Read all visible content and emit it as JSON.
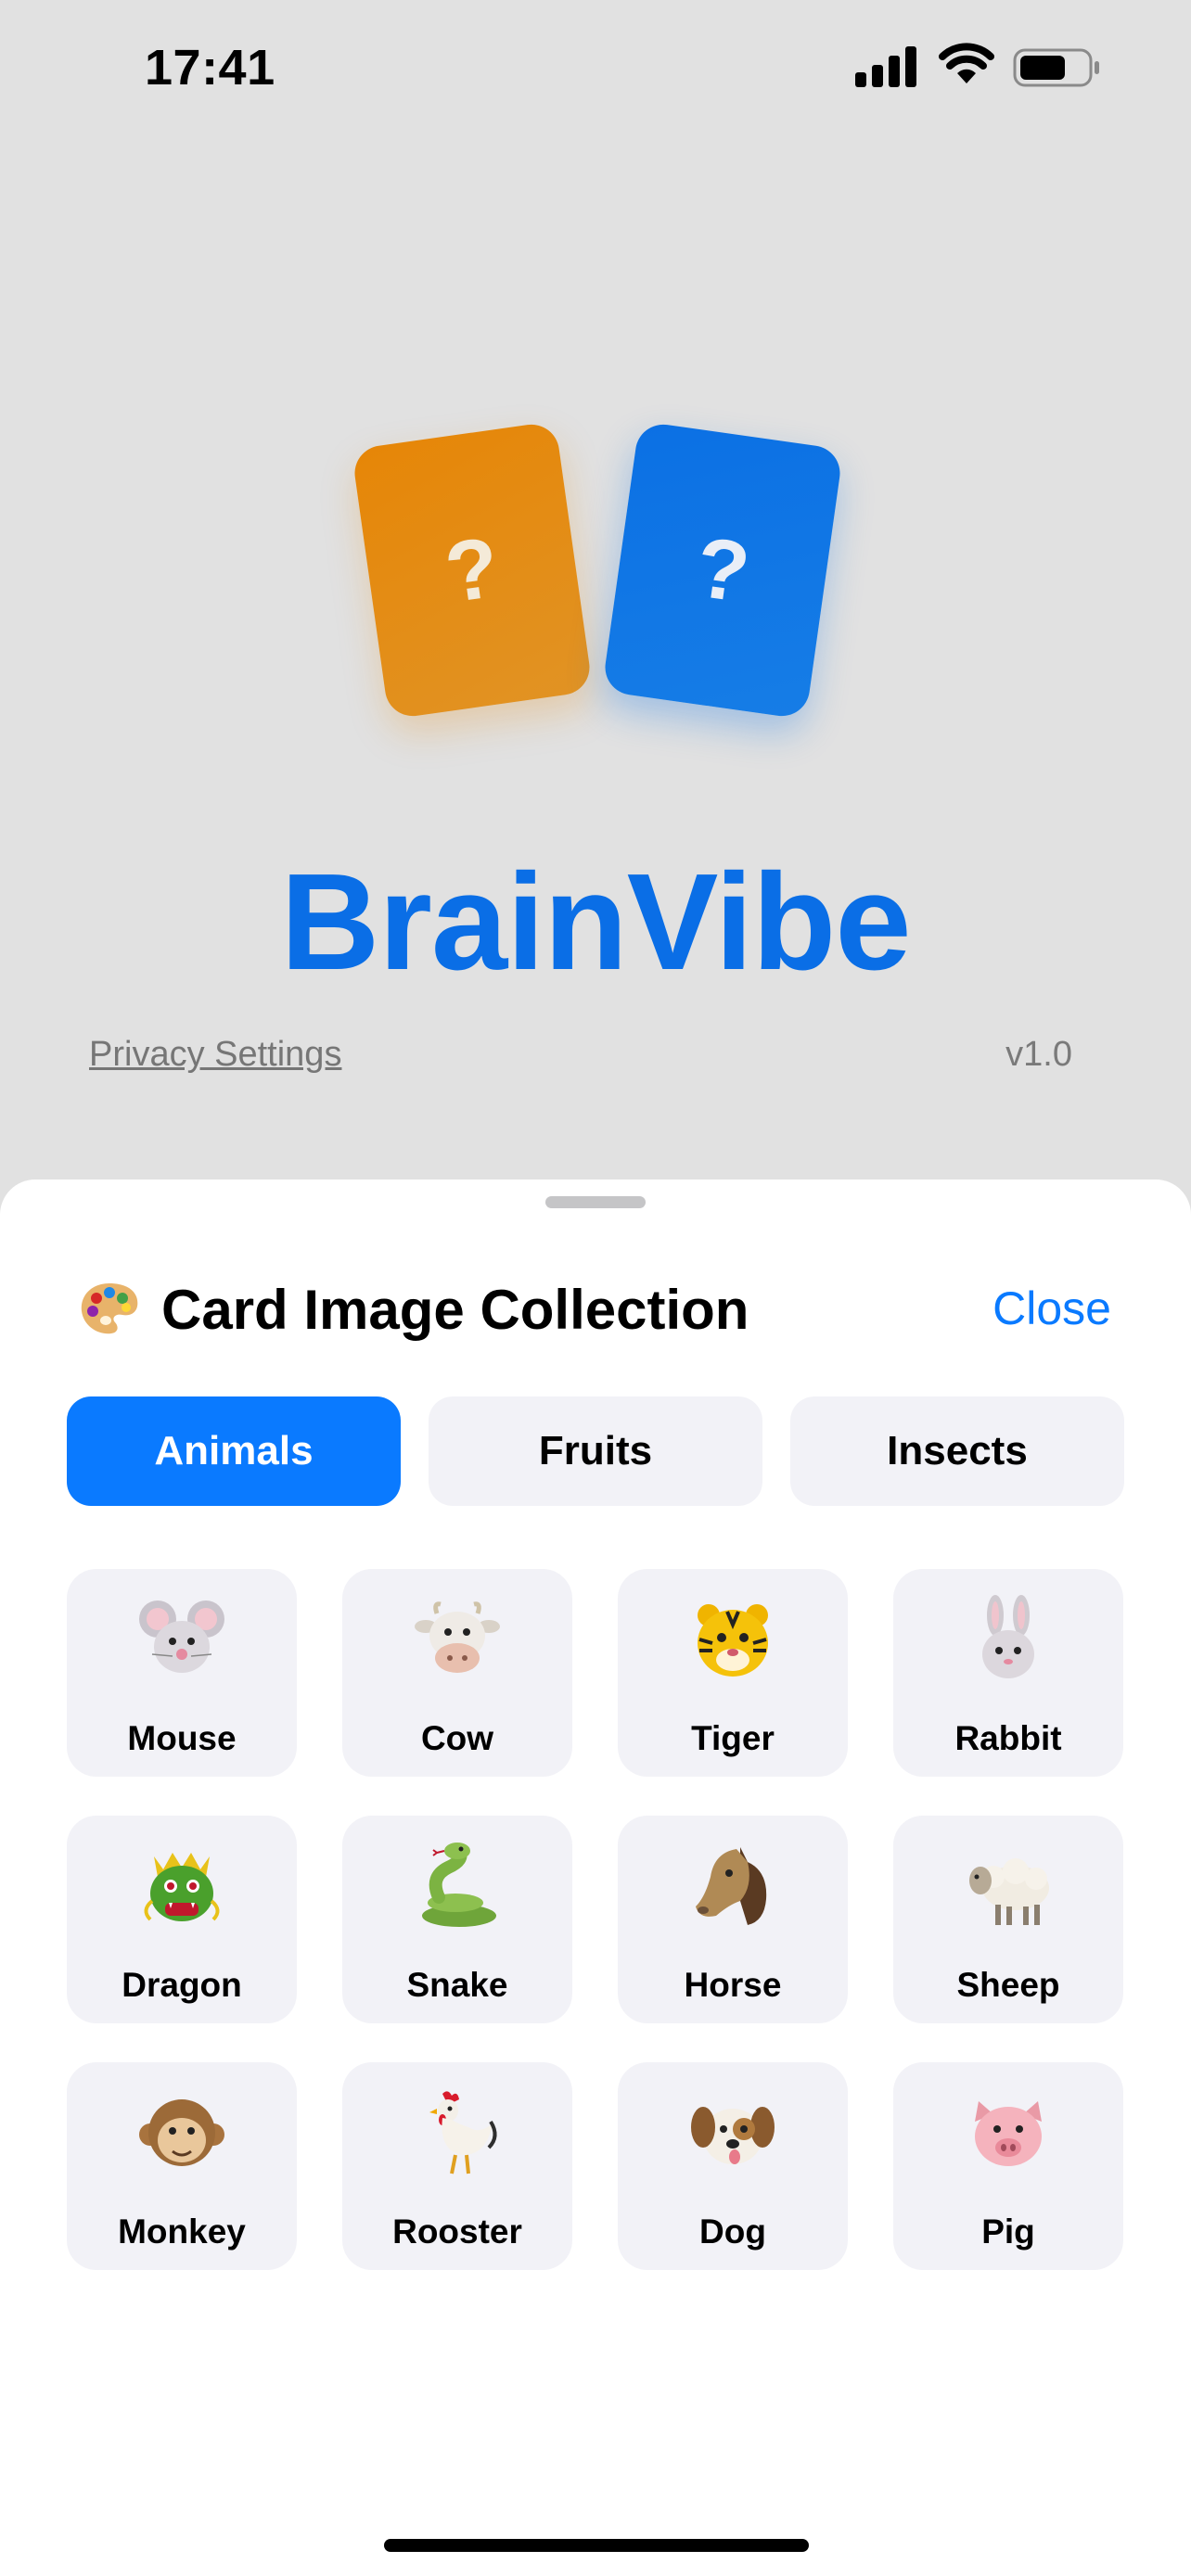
{
  "status_bar": {
    "time": "17:41"
  },
  "cards": [
    {
      "symbol": "?",
      "color": "#e68607"
    },
    {
      "symbol": "?",
      "color": "#0b70e4"
    }
  ],
  "app": {
    "title": "BrainVibe",
    "title_color": "#0a6ee6",
    "privacy_link": "Privacy Settings",
    "version": "v1.0"
  },
  "sheet": {
    "title": "Card Image Collection",
    "title_icon": "artist-palette-icon",
    "close_label": "Close",
    "accent_color": "#0a7aff",
    "tabs": [
      {
        "label": "Animals",
        "active": true
      },
      {
        "label": "Fruits",
        "active": false
      },
      {
        "label": "Insects",
        "active": false
      }
    ],
    "animals": [
      {
        "label": "Mouse",
        "icon": "mouse-icon"
      },
      {
        "label": "Cow",
        "icon": "cow-icon"
      },
      {
        "label": "Tiger",
        "icon": "tiger-icon"
      },
      {
        "label": "Rabbit",
        "icon": "rabbit-icon"
      },
      {
        "label": "Dragon",
        "icon": "dragon-icon"
      },
      {
        "label": "Snake",
        "icon": "snake-icon"
      },
      {
        "label": "Horse",
        "icon": "horse-icon"
      },
      {
        "label": "Sheep",
        "icon": "sheep-icon"
      },
      {
        "label": "Monkey",
        "icon": "monkey-icon"
      },
      {
        "label": "Rooster",
        "icon": "rooster-icon"
      },
      {
        "label": "Dog",
        "icon": "dog-icon"
      },
      {
        "label": "Pig",
        "icon": "pig-icon"
      }
    ]
  }
}
